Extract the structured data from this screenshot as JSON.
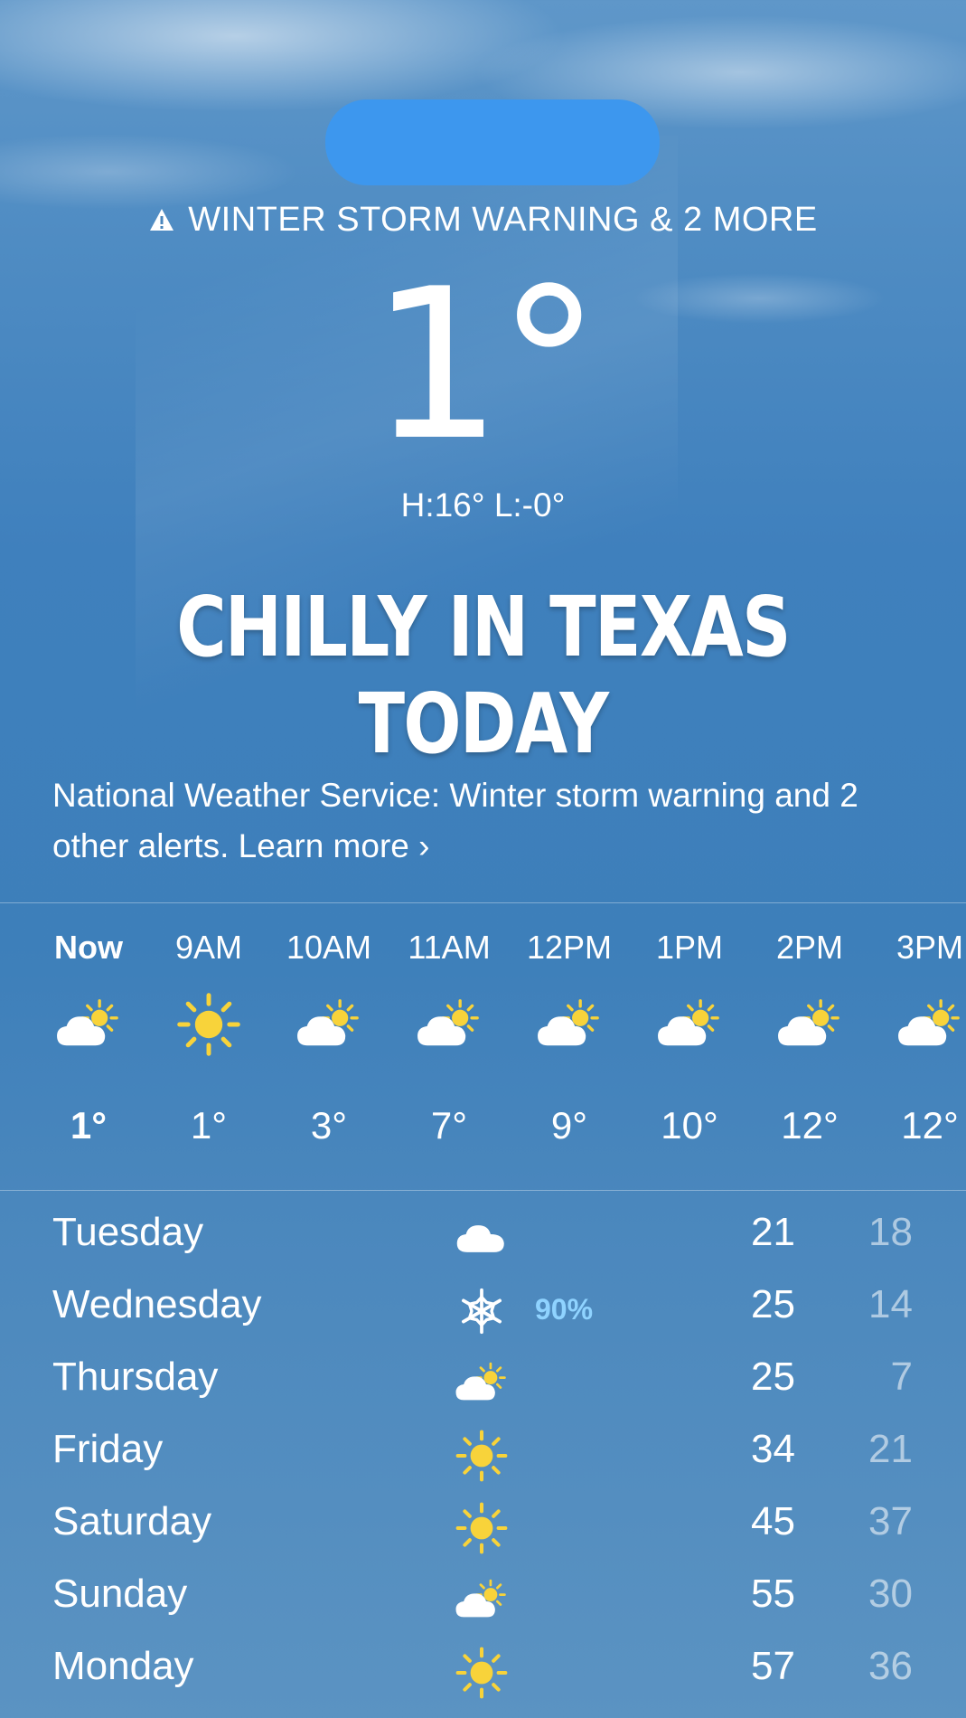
{
  "alert": {
    "text": "WINTER STORM WARNING & 2 MORE",
    "icon": "warning-triangle-icon"
  },
  "current": {
    "temperature": "1°",
    "hilo": "H:16°  L:-0°"
  },
  "headline": "CHILLY IN TEXAS TODAY",
  "nws_notice": {
    "text": "National Weather Service: Winter storm warning and 2 other alerts. Learn more",
    "chevron": "›"
  },
  "hourly": [
    {
      "time": "Now",
      "icon": "partly-sunny-icon",
      "temp": "1°"
    },
    {
      "time": "9AM",
      "icon": "sun-icon",
      "temp": "1°"
    },
    {
      "time": "10AM",
      "icon": "partly-sunny-icon",
      "temp": "3°"
    },
    {
      "time": "11AM",
      "icon": "partly-sunny-icon",
      "temp": "7°"
    },
    {
      "time": "12PM",
      "icon": "partly-sunny-icon",
      "temp": "9°"
    },
    {
      "time": "1PM",
      "icon": "partly-sunny-icon",
      "temp": "10°"
    },
    {
      "time": "2PM",
      "icon": "partly-sunny-icon",
      "temp": "12°"
    },
    {
      "time": "3PM",
      "icon": "partly-sunny-icon",
      "temp": "12°"
    }
  ],
  "daily": [
    {
      "day": "Tuesday",
      "icon": "cloud-icon",
      "precip": "",
      "high": "21",
      "low": "18"
    },
    {
      "day": "Wednesday",
      "icon": "snowflake-icon",
      "precip": "90%",
      "high": "25",
      "low": "14"
    },
    {
      "day": "Thursday",
      "icon": "partly-sunny-icon",
      "precip": "",
      "high": "25",
      "low": "7"
    },
    {
      "day": "Friday",
      "icon": "sun-icon",
      "precip": "",
      "high": "34",
      "low": "21"
    },
    {
      "day": "Saturday",
      "icon": "sun-icon",
      "precip": "",
      "high": "45",
      "low": "37"
    },
    {
      "day": "Sunday",
      "icon": "partly-sunny-icon",
      "precip": "",
      "high": "55",
      "low": "30"
    },
    {
      "day": "Monday",
      "icon": "sun-icon",
      "precip": "",
      "high": "57",
      "low": "36"
    }
  ],
  "colors": {
    "sun": "#f8d33a",
    "precip": "#8fd3ff",
    "redaction": "#3d97ee"
  }
}
